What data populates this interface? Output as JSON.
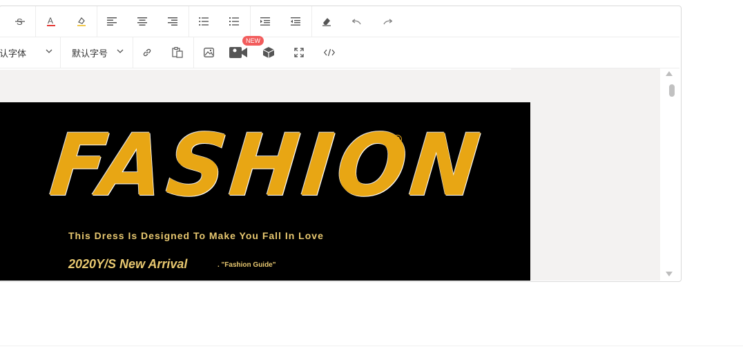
{
  "toolbar": {
    "row1": [
      {
        "name": "strikethrough-icon",
        "label": "S"
      },
      {
        "name": "font-color-icon",
        "label": "A"
      },
      {
        "name": "highlight-icon",
        "label": ""
      },
      {
        "name": "align-left-icon",
        "label": ""
      },
      {
        "name": "align-center-icon",
        "label": ""
      },
      {
        "name": "align-right-icon",
        "label": ""
      },
      {
        "name": "bulleted-list-icon",
        "label": ""
      },
      {
        "name": "numbered-list-icon",
        "label": ""
      },
      {
        "name": "indent-icon",
        "label": ""
      },
      {
        "name": "outdent-icon",
        "label": ""
      },
      {
        "name": "clear-format-icon",
        "label": ""
      },
      {
        "name": "undo-icon",
        "label": ""
      },
      {
        "name": "redo-icon",
        "label": ""
      }
    ],
    "font_family_value": "认字体",
    "font_size_value": "默认字号",
    "new_badge": "NEW",
    "colors": {
      "font_color_underline": "#e53935",
      "highlight_underline": "#f2c94c",
      "badge": "#f25c5c"
    }
  },
  "banner": {
    "title": "FASHION",
    "registered_mark": "®",
    "tagline": "This Dress Is Designed To Make You Fall In Love",
    "arrival": "2020Y/S New Arrival",
    "guide": ". \"Fashion Guide\"",
    "accent_color": "#e8a614"
  }
}
